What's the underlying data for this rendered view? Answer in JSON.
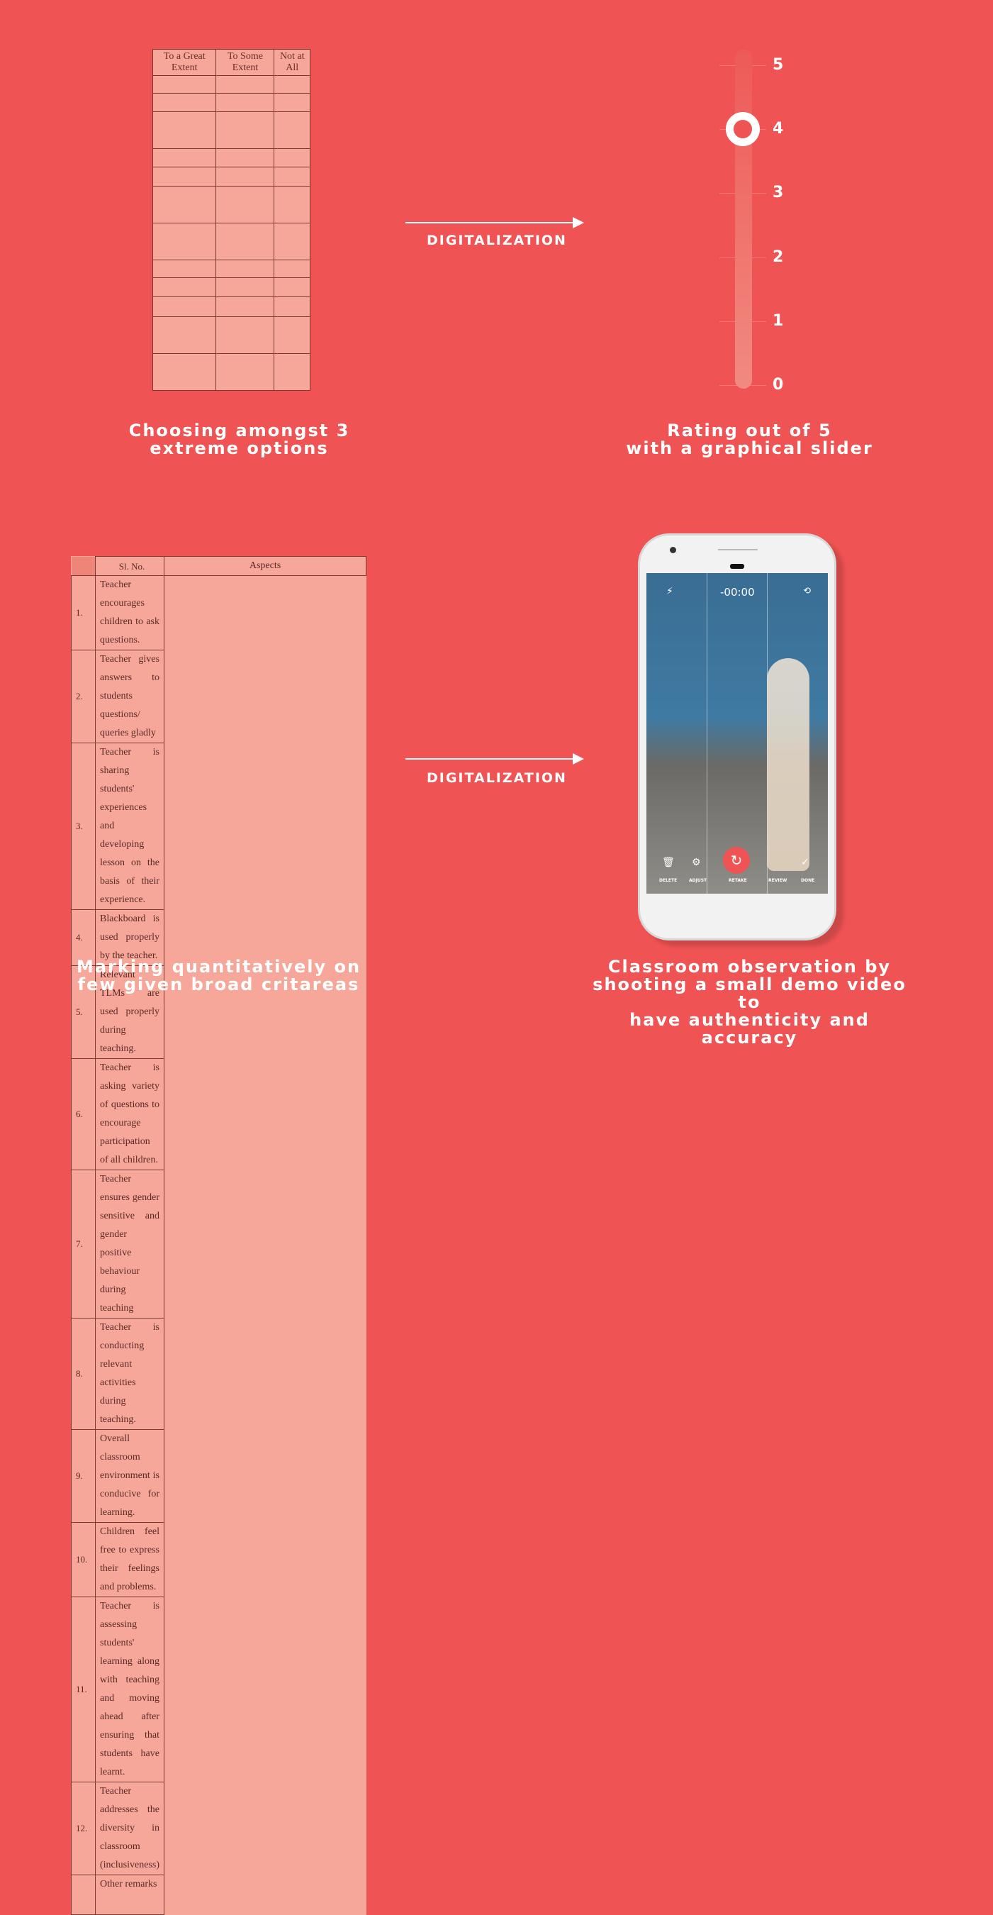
{
  "panel1": {
    "headers": [
      "To a Great Extent",
      "To Some Extent",
      "Not at All"
    ],
    "caption": [
      "Choosing amongst 3",
      "extreme options"
    ]
  },
  "arrow_label": "DIGITALIZATION",
  "panel2": {
    "scale": [
      "5",
      "4",
      "3",
      "2",
      "1",
      "0"
    ],
    "value": 4,
    "caption": [
      "Rating out of 5",
      "with a graphical slider"
    ]
  },
  "panel3": {
    "headers": [
      "Sl. No.",
      "Aspects"
    ],
    "rows": [
      [
        "1.",
        "Teacher encourages children to ask questions."
      ],
      [
        "2.",
        "Teacher gives answers to students questions/ queries gladly"
      ],
      [
        "3.",
        "Teacher is sharing students' experiences and developing lesson on the basis of their experience."
      ],
      [
        "4.",
        "Blackboard is used properly by the teacher."
      ],
      [
        "5.",
        "Relevant TLMs are used properly during teaching."
      ],
      [
        "6.",
        "Teacher is asking variety of questions to encourage participation of all children."
      ],
      [
        "7.",
        "Teacher ensures gender sensitive and gender positive behaviour during teaching"
      ],
      [
        "8.",
        "Teacher is conducting relevant activities during teaching."
      ],
      [
        "9.",
        "Overall classroom environment is conducive for learning."
      ],
      [
        "10.",
        "Children feel free to express their feelings and problems."
      ],
      [
        "11.",
        "Teacher is assessing students' learning along with teaching and moving ahead after ensuring that students have learnt."
      ],
      [
        "12.",
        "Teacher addresses the diversity in classroom (inclusiveness)"
      ],
      [
        "",
        "Other remarks"
      ]
    ],
    "caption": [
      "Marking quantitatively on",
      "few given broad critareas"
    ]
  },
  "panel4": {
    "timer": "-00:00",
    "buttons": [
      "DELETE",
      "ADJUST",
      "RETAKE",
      "REVIEW",
      "DONE"
    ],
    "accent": "#ef5353",
    "caption": [
      "Classroom observation by",
      "shooting a small demo video to",
      "have authenticity and accuracy"
    ]
  }
}
